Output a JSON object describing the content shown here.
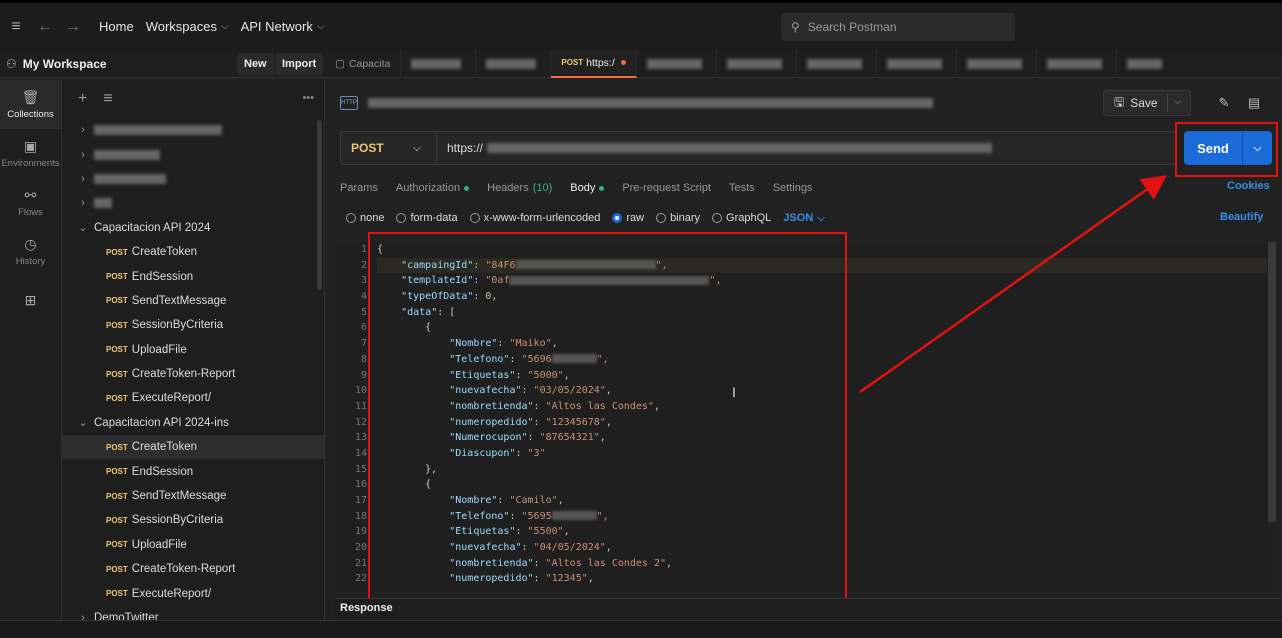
{
  "topbar": {
    "home": "Home",
    "workspaces": "Workspaces",
    "api_network": "API Network",
    "search_placeholder": "Search Postman"
  },
  "workspace": {
    "title": "My Workspace",
    "new_label": "New",
    "import_label": "Import"
  },
  "rail": {
    "collections": "Collections",
    "environments": "Environments",
    "flows": "Flows",
    "history": "History"
  },
  "sidebar": {
    "collection1": "Capacitacion API 2024",
    "collection1_items": [
      "CreateToken",
      "EndSession",
      "SendTextMessage",
      "SessionByCriteria",
      "UploadFile",
      "CreateToken-Report",
      "ExecuteReport/"
    ],
    "collection2": "Capacitacion API 2024-ins",
    "collection2_items": [
      "CreateToken",
      "EndSession",
      "SendTextMessage",
      "SessionByCriteria",
      "UploadFile",
      "CreateToken-Report",
      "ExecuteReport/"
    ],
    "collection3": "DemoTwitter",
    "method": "POST"
  },
  "tabs": {
    "first": "Capacita",
    "active_method": "POST",
    "active_label": "https:/"
  },
  "request": {
    "save_label": "Save",
    "method": "POST",
    "url_prefix": "https://",
    "send_label": "Send",
    "http_badge": "HTTP"
  },
  "req_tabs": {
    "params": "Params",
    "authorization": "Authorization",
    "headers": "Headers",
    "headers_count": "(10)",
    "body": "Body",
    "pre_request": "Pre-request Script",
    "tests": "Tests",
    "settings": "Settings",
    "cookies": "Cookies"
  },
  "body_options": {
    "none": "none",
    "form_data": "form-data",
    "urlencoded": "x-www-form-urlencoded",
    "raw": "raw",
    "binary": "binary",
    "graphql": "GraphQL",
    "json": "JSON",
    "beautify": "Beautify"
  },
  "editor": {
    "line_numbers": [
      "1",
      "2",
      "3",
      "4",
      "5",
      "6",
      "7",
      "8",
      "9",
      "10",
      "11",
      "12",
      "13",
      "14",
      "15",
      "16",
      "17",
      "18",
      "19",
      "20",
      "21",
      "22"
    ],
    "campaign_key": "\"campaingId\"",
    "campaign_val": "\"84F6",
    "template_key": "\"templateId\"",
    "template_val": "\"0af",
    "type_key": "\"typeOfData\"",
    "type_val": "0",
    "data_key": "\"data\"",
    "records": [
      {
        "nombre": "\"Maiko\"",
        "telefono": "\"5696",
        "etiquetas": "\"5000\"",
        "fecha": "\"03/05/2024\"",
        "tienda": "\"Altos las Condes\"",
        "pedido": "\"12345678\"",
        "cupon": "\"87654321\"",
        "descupon": "\"3\""
      },
      {
        "nombre": "\"Camilo\"",
        "telefono": "\"5695",
        "etiquetas": "\"5500\"",
        "fecha": "\"04/05/2024\"",
        "tienda": "\"Altos las Condes 2\"",
        "pedido": "\"12345\""
      }
    ],
    "keys": {
      "nombre": "\"Nombre\"",
      "telefono": "\"Telefono\"",
      "etiquetas": "\"Etiquetas\"",
      "fecha": "\"nuevafecha\"",
      "tienda": "\"nombretienda\"",
      "pedido": "\"numeropedido\"",
      "cupon": "\"Numerocupon\"",
      "descupon": "\"Diascupon\""
    }
  },
  "response": {
    "label": "Response"
  },
  "colors": {
    "accent": "#1a6ad8",
    "annotation": "#e31212",
    "post": "#f0c674"
  }
}
